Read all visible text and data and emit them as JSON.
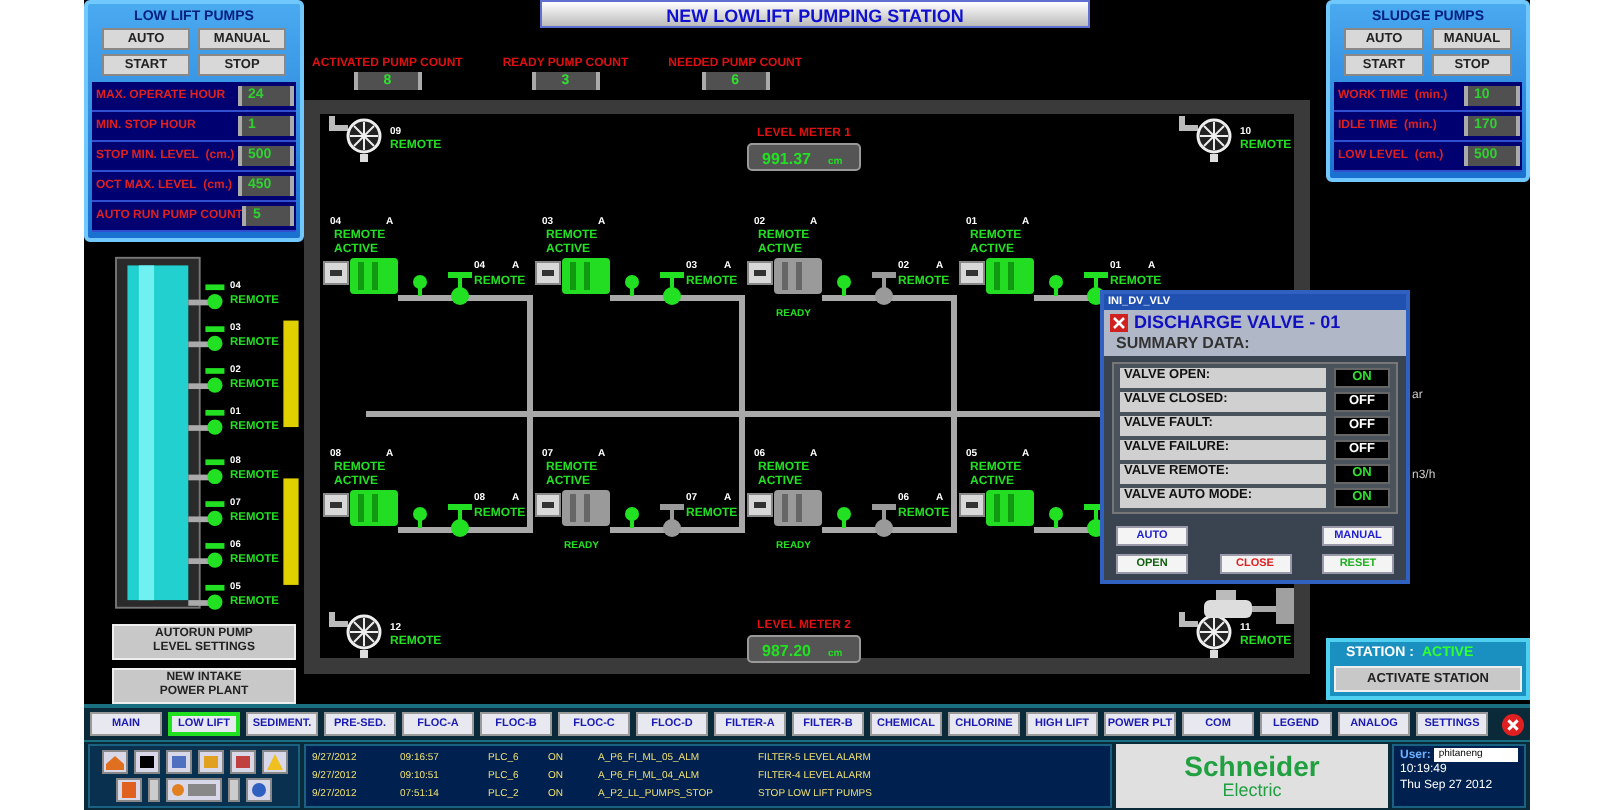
{
  "low_lift_panel": {
    "title": "LOW LIFT PUMPS",
    "buttons": [
      "AUTO",
      "MANUAL",
      "START",
      "STOP"
    ],
    "settings": [
      {
        "label": "MAX. OPERATE HOUR",
        "value": "24"
      },
      {
        "label": "MIN. STOP HOUR",
        "value": "1"
      },
      {
        "label": "STOP MIN. LEVEL",
        "unit": "(cm.)",
        "value": "500"
      },
      {
        "label": "OCT MAX. LEVEL",
        "unit": "(cm.)",
        "value": "450"
      },
      {
        "label": "AUTO RUN PUMP COUNT",
        "value": "5"
      }
    ]
  },
  "title": "NEW LOWLIFT PUMPING STATION",
  "counts": [
    {
      "label": "ACTIVATED PUMP COUNT",
      "value": "8"
    },
    {
      "label": "READY PUMP COUNT",
      "value": "3"
    },
    {
      "label": "NEEDED PUMP COUNT",
      "value": "6"
    }
  ],
  "sludge_panel": {
    "title": "SLUDGE PUMPS",
    "buttons": [
      "AUTO",
      "MANUAL",
      "START",
      "STOP"
    ],
    "settings": [
      {
        "label": "WORK TIME",
        "unit": "(min.)",
        "value": "10"
      },
      {
        "label": "IDLE TIME",
        "unit": "(min.)",
        "value": "170"
      },
      {
        "label": "LOW LEVEL",
        "unit": "(cm.)",
        "value": "500"
      }
    ]
  },
  "intake_valves": [
    {
      "number": "04",
      "status": "REMOTE"
    },
    {
      "number": "03",
      "status": "REMOTE"
    },
    {
      "number": "02",
      "status": "REMOTE"
    },
    {
      "number": "01",
      "status": "REMOTE"
    },
    {
      "number": "08",
      "status": "REMOTE"
    },
    {
      "number": "07",
      "status": "REMOTE"
    },
    {
      "number": "06",
      "status": "REMOTE"
    },
    {
      "number": "05",
      "status": "REMOTE"
    }
  ],
  "side_buttons": [
    {
      "lines": [
        "AUTORUN PUMP",
        "LEVEL SETTINGS"
      ]
    },
    {
      "lines": [
        "NEW INTAKE",
        "POWER PLANT"
      ]
    }
  ],
  "diagram": {
    "aux_pumps": [
      {
        "number": "09",
        "status": "REMOTE"
      },
      {
        "number": "10",
        "status": "REMOTE"
      },
      {
        "number": "12",
        "status": "REMOTE"
      },
      {
        "number": "11",
        "status": "REMOTE"
      }
    ],
    "level_meters": [
      {
        "label": "LEVEL METER 1",
        "value": "991.37",
        "unit": "cm"
      },
      {
        "label": "LEVEL METER 2",
        "value": "987.20",
        "unit": "cm"
      }
    ],
    "units": [
      {
        "pump": {
          "number": "04",
          "mode": "A",
          "status": [
            "REMOTE",
            "ACTIVE"
          ],
          "active": true
        },
        "valve": {
          "number": "04",
          "mode": "A",
          "status": "REMOTE",
          "open": true
        }
      },
      {
        "pump": {
          "number": "03",
          "mode": "A",
          "status": [
            "REMOTE",
            "ACTIVE"
          ],
          "active": true
        },
        "valve": {
          "number": "03",
          "mode": "A",
          "status": "REMOTE",
          "open": true
        }
      },
      {
        "pump": {
          "number": "02",
          "mode": "A",
          "status": [
            "REMOTE",
            "ACTIVE"
          ],
          "active": false,
          "ready_label": "READY"
        },
        "valve": {
          "number": "02",
          "mode": "A",
          "status": "REMOTE",
          "open": false
        }
      },
      {
        "pump": {
          "number": "01",
          "mode": "A",
          "status": [
            "REMOTE",
            "ACTIVE"
          ],
          "active": true
        },
        "valve": {
          "number": "01",
          "mode": "A",
          "status": "REMOTE",
          "open": true
        }
      },
      {
        "pump": {
          "number": "08",
          "mode": "A",
          "status": [
            "REMOTE",
            "ACTIVE"
          ],
          "active": true
        },
        "valve": {
          "number": "08",
          "mode": "A",
          "status": "REMOTE",
          "open": true
        }
      },
      {
        "pump": {
          "number": "07",
          "mode": "A",
          "status": [
            "REMOTE",
            "ACTIVE"
          ],
          "active": false,
          "ready_label": "READY"
        },
        "valve": {
          "number": "07",
          "mode": "A",
          "status": "REMOTE",
          "open": false
        }
      },
      {
        "pump": {
          "number": "06",
          "mode": "A",
          "status": [
            "REMOTE",
            "ACTIVE"
          ],
          "active": false,
          "ready_label": "READY"
        },
        "valve": {
          "number": "06",
          "mode": "A",
          "status": "REMOTE",
          "open": false
        }
      },
      {
        "pump": {
          "number": "05",
          "mode": "A",
          "status": [
            "REMOTE",
            "ACTIVE"
          ],
          "active": true
        },
        "valve": {
          "open": true
        }
      }
    ]
  },
  "side_fragments": [
    "ar",
    "n3/h"
  ],
  "popup": {
    "window_title": "INI_DV_VLV",
    "title": "DISCHARGE VALVE - 01",
    "subtitle": "SUMMARY DATA:",
    "rows": [
      {
        "label": "VALVE OPEN:",
        "value": "ON",
        "on": true
      },
      {
        "label": "VALVE CLOSED:",
        "value": "OFF",
        "on": false
      },
      {
        "label": "VALVE FAULT:",
        "value": "OFF",
        "on": false
      },
      {
        "label": "VALVE FAILURE:",
        "value": "OFF",
        "on": false
      },
      {
        "label": "VALVE REMOTE:",
        "value": "ON",
        "on": true
      },
      {
        "label": "VALVE AUTO MODE:",
        "value": "ON",
        "on": true
      }
    ],
    "buttons": [
      {
        "label": "AUTO",
        "color": "#2020d0"
      },
      {
        "label": "MANUAL",
        "color": "#2020d0"
      },
      {
        "label": "OPEN",
        "color": "#106010"
      },
      {
        "label": "CLOSE",
        "color": "#e02020"
      },
      {
        "label": "RESET",
        "color": "#20b020"
      }
    ]
  },
  "station": {
    "label": "STATION :",
    "status": "ACTIVE",
    "button": "ACTIVATE STATION"
  },
  "nav_tabs": [
    {
      "label": "MAIN",
      "selected": false
    },
    {
      "label": "LOW LIFT",
      "selected": true
    },
    {
      "label": "SEDIMENT.",
      "selected": false
    },
    {
      "label": "PRE-SED.",
      "selected": false
    },
    {
      "label": "FLOC-A",
      "selected": false
    },
    {
      "label": "FLOC-B",
      "selected": false
    },
    {
      "label": "FLOC-C",
      "selected": false
    },
    {
      "label": "FLOC-D",
      "selected": false
    },
    {
      "label": "FILTER-A",
      "selected": false
    },
    {
      "label": "FILTER-B",
      "selected": false
    },
    {
      "label": "CHEMICAL",
      "selected": false
    },
    {
      "label": "CHLORINE",
      "selected": false
    },
    {
      "label": "HIGH LIFT",
      "selected": false
    },
    {
      "label": "POWER PLT",
      "selected": false
    },
    {
      "label": "COM",
      "selected": false
    },
    {
      "label": "LEGEND",
      "selected": false
    },
    {
      "label": "ANALOG",
      "selected": false
    },
    {
      "label": "SETTINGS",
      "selected": false
    }
  ],
  "alarms": [
    {
      "date": "9/27/2012",
      "time": "09:16:57",
      "source": "PLC_6",
      "state": "ON",
      "tag": "A_P6_FI_ML_05_ALM",
      "message": "FILTER-5 LEVEL ALARM"
    },
    {
      "date": "9/27/2012",
      "time": "09:10:51",
      "source": "PLC_6",
      "state": "ON",
      "tag": "A_P6_FI_ML_04_ALM",
      "message": "FILTER-4 LEVEL ALARM"
    },
    {
      "date": "9/27/2012",
      "time": "07:51:14",
      "source": "PLC_2",
      "state": "ON",
      "tag": "A_P2_LL_PUMPS_STOP",
      "message": "STOP LOW LIFT PUMPS"
    }
  ],
  "logo": {
    "name": "Schneider",
    "sub": "Electric"
  },
  "user": {
    "label": "User:",
    "value": "phitaneng"
  },
  "clock": {
    "time": "10:19:49",
    "date": "Thu Sep 27 2012"
  }
}
